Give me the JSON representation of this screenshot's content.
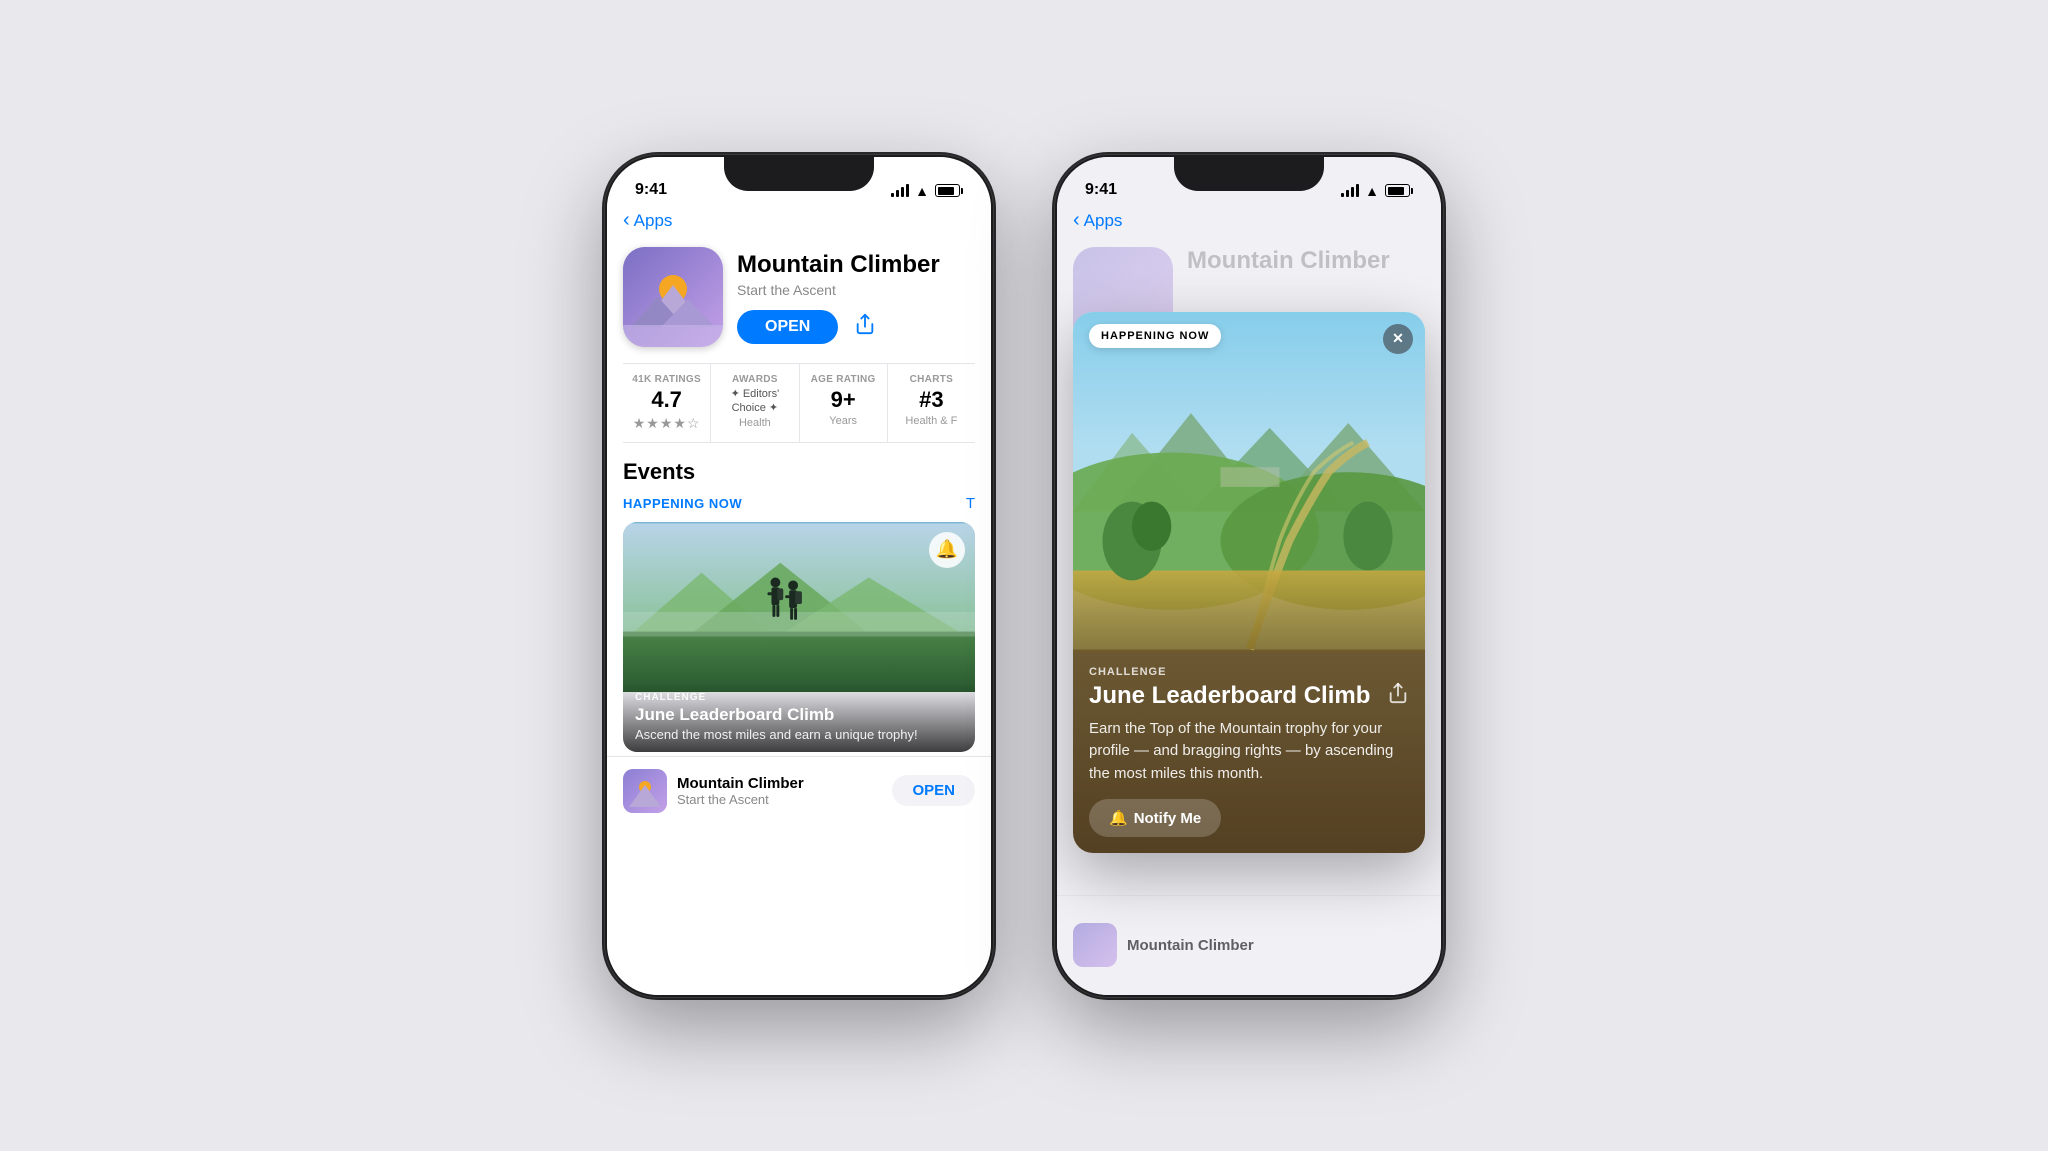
{
  "background": "#e8e8ed",
  "phone1": {
    "status_time": "9:41",
    "back_label": "Apps",
    "app_name": "Mountain Climber",
    "app_tagline": "Start the Ascent",
    "open_button": "OPEN",
    "ratings": [
      {
        "label": "41K RATINGS",
        "value": "4.7",
        "sub": "★★★★☆"
      },
      {
        "label": "AWARDS",
        "value": "Editors' Choice",
        "sub": "Health"
      },
      {
        "label": "AGE RATING",
        "value": "9+",
        "sub": "Years"
      },
      {
        "label": "CHARTS",
        "value": "#3",
        "sub": "Health & F"
      }
    ],
    "events_title": "Events",
    "happening_now": "HAPPENING NOW",
    "see_more": "T",
    "event_type": "CHALLENGE",
    "event_title": "June Leaderboard Climb",
    "event_desc": "Ascend the most miles and earn a unique trophy!",
    "bottom_app_name": "Mountain Climber",
    "bottom_app_tag": "Start the Ascent",
    "bottom_open": "OPEN"
  },
  "phone2": {
    "status_time": "9:41",
    "back_label": "Apps",
    "app_name_blurred": "Mountain Climber",
    "overlay": {
      "badge": "HAPPENING NOW",
      "close": "✕",
      "event_type": "CHALLENGE",
      "event_title": "June Leaderboard Climb",
      "event_desc": "Earn the Top of the Mountain trophy for your profile — and bragging rights — by ascending the most miles this month.",
      "notify_btn": "Notify Me"
    }
  }
}
